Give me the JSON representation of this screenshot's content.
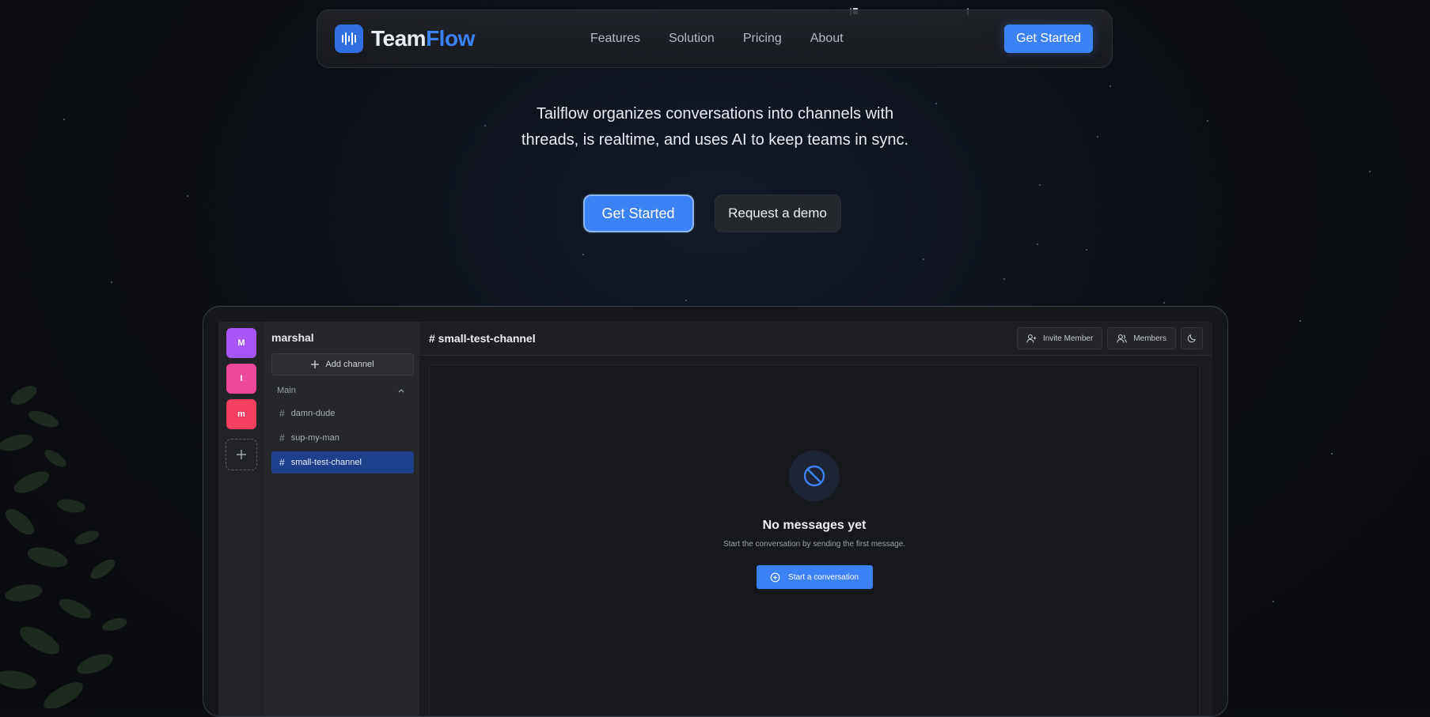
{
  "colors": {
    "accent": "#3b82f6",
    "workspace_1": "#a855f7",
    "workspace_2": "#ec4899",
    "workspace_3": "#f43f5e",
    "active_channel": "#1e3f8c"
  },
  "nav": {
    "brand_part1": "Team",
    "brand_part2": "Flow",
    "logo_icon": "audio-wave-icon",
    "links": [
      "Features",
      "Solution",
      "Pricing",
      "About"
    ],
    "cta": "Get Started"
  },
  "hero": {
    "tagline_line1": "Tailflow organizes conversations into channels with",
    "tagline_line2": "threads, is realtime, and uses AI to keep teams in sync.",
    "primary_button": "Get Started",
    "secondary_button": "Request a demo"
  },
  "app": {
    "workspaces": [
      {
        "letter": "M",
        "color": "#a855f7"
      },
      {
        "letter": "I",
        "color": "#ec4899"
      },
      {
        "letter": "m",
        "color": "#f43f5e"
      }
    ],
    "add_workspace_icon": "plus-icon",
    "workspace_name": "marshal",
    "add_channel_label": "Add channel",
    "section_label": "Main",
    "channels": [
      {
        "name": "damn-dude",
        "active": false
      },
      {
        "name": "sup-my-man",
        "active": false
      },
      {
        "name": "small-test-channel",
        "active": true
      }
    ],
    "current_channel": "# small-test-channel",
    "invite_label": "Invite Member",
    "members_label": "Members",
    "theme_icon": "moon-icon",
    "empty_title": "No messages yet",
    "empty_subtitle": "Start the conversation by sending the first message.",
    "start_button": "Start a conversation"
  }
}
